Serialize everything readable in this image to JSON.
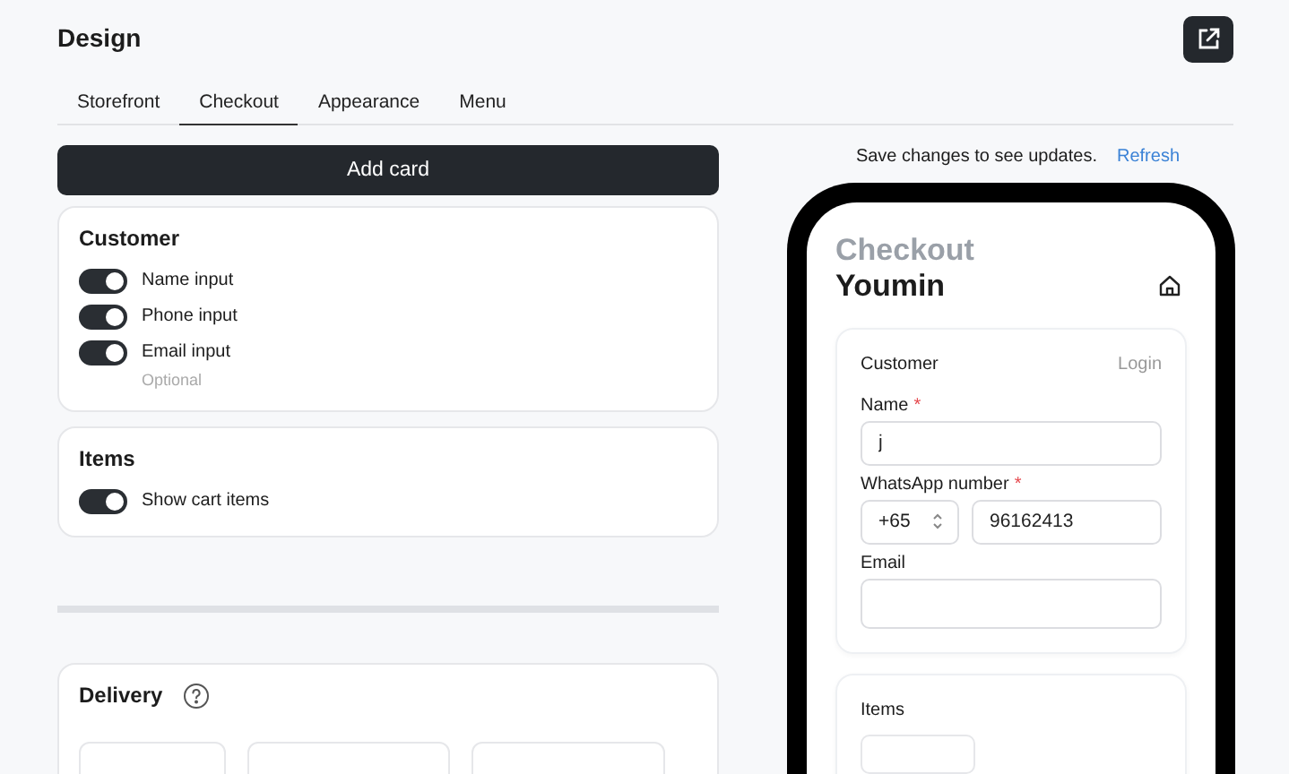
{
  "header": {
    "title": "Design"
  },
  "tabs": [
    {
      "label": "Storefront",
      "selected": false
    },
    {
      "label": "Checkout",
      "selected": true
    },
    {
      "label": "Appearance",
      "selected": false
    },
    {
      "label": "Menu",
      "selected": false
    }
  ],
  "add_card_button": "Add card",
  "cards": [
    {
      "title": "Customer",
      "toggles": [
        {
          "label": "Name input",
          "on": true
        },
        {
          "label": "Phone input",
          "on": true
        },
        {
          "label": "Email input",
          "on": true,
          "hint": "Optional"
        }
      ]
    },
    {
      "title": "Items",
      "toggles": [
        {
          "label": "Show cart items",
          "on": true
        }
      ]
    }
  ],
  "delivery": {
    "title": "Delivery"
  },
  "preview": {
    "notice": "Save changes to see updates.",
    "refresh_link": "Refresh",
    "page_title": "Checkout",
    "store_name": "Youmin",
    "customer": {
      "title": "Customer",
      "login_link": "Login",
      "fields": [
        {
          "kind": "text",
          "label": "Name",
          "required_mark": "*",
          "value": "j"
        },
        {
          "kind": "phone",
          "label": "WhatsApp number",
          "required_mark": "*",
          "code": "+65",
          "value": "96162413"
        },
        {
          "kind": "text",
          "label": "Email"
        }
      ]
    },
    "items": {
      "title": "Items"
    }
  }
}
